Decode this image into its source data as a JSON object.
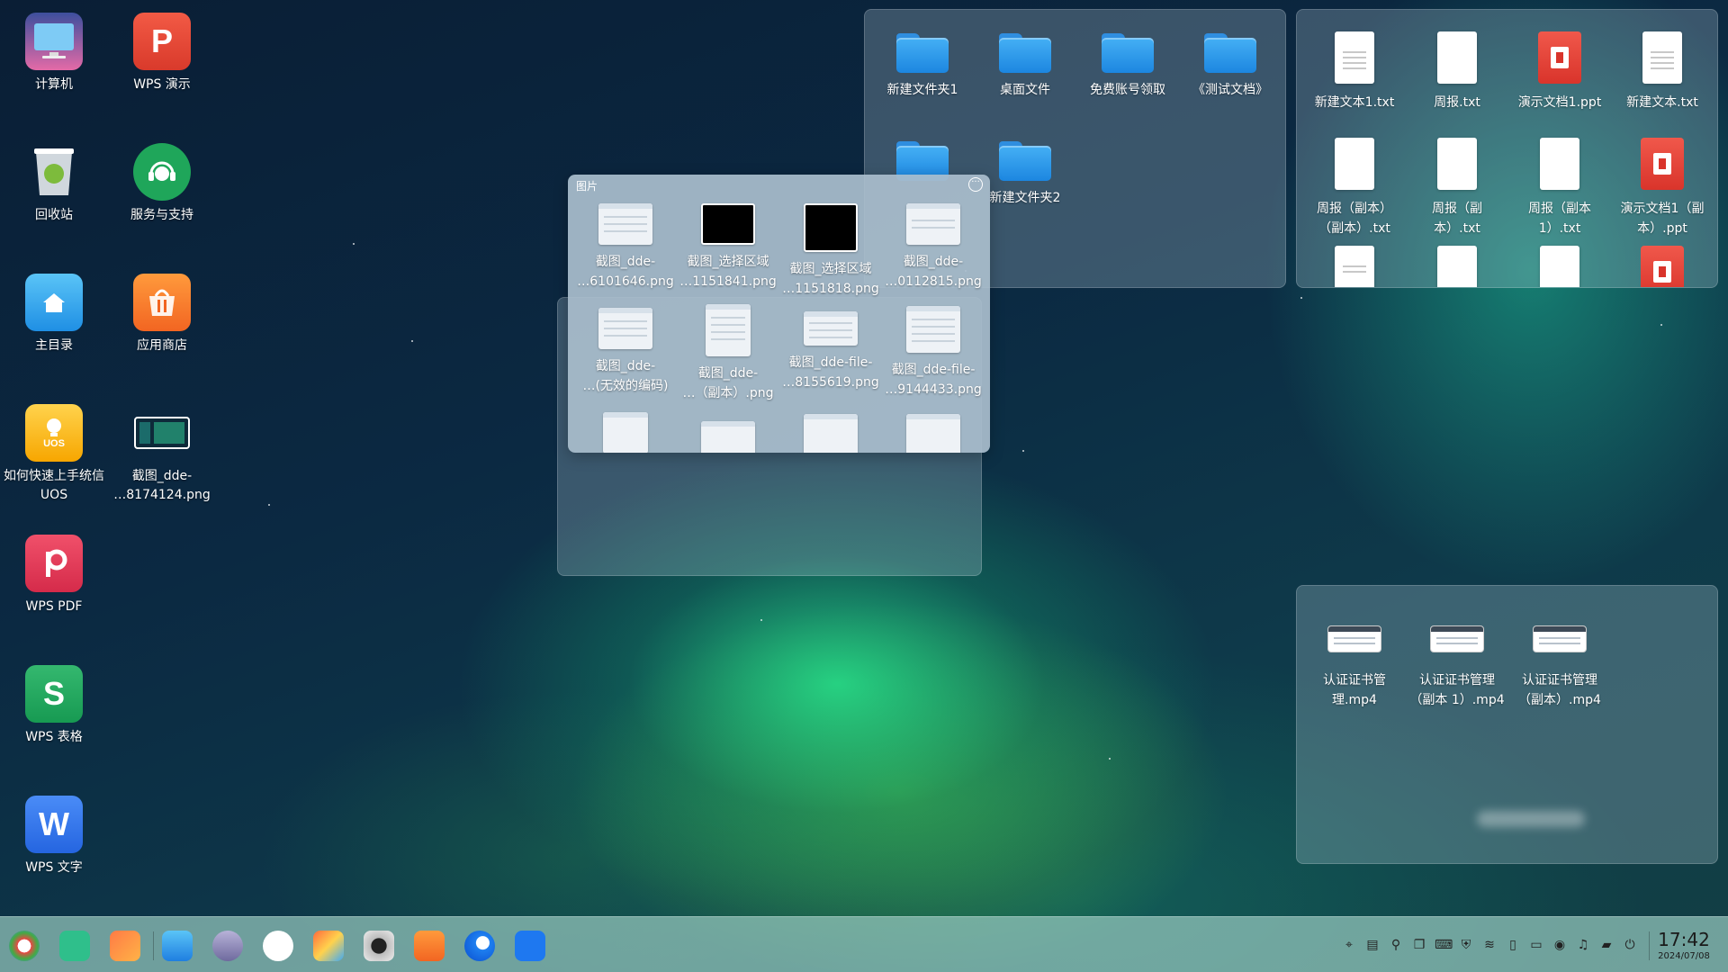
{
  "desktop": {
    "icons": [
      {
        "label": "计算机",
        "icon": "computer-icon"
      },
      {
        "label": "WPS 演示",
        "icon": "wps-presentation-icon"
      },
      {
        "label": "回收站",
        "icon": "trash-icon"
      },
      {
        "label": "服务与支持",
        "icon": "support-icon"
      },
      {
        "label": "主目录",
        "icon": "home-folder-icon"
      },
      {
        "label": "应用商店",
        "icon": "app-store-icon"
      },
      {
        "label": "如何快速上手统信UOS",
        "icon": "uos-guide-icon"
      },
      {
        "label": "截图_dde-\n…8174124.png",
        "icon": "image-file-icon"
      },
      {
        "label": "WPS PDF",
        "icon": "wps-pdf-icon"
      },
      {
        "label": "WPS 表格",
        "icon": "wps-spreadsheet-icon"
      },
      {
        "label": "WPS 文字",
        "icon": "wps-writer-icon"
      }
    ]
  },
  "folders_panel": {
    "items": [
      {
        "label": "新建文件夹1"
      },
      {
        "label": "桌面文件"
      },
      {
        "label": "免费账号领取"
      },
      {
        "label": "《测试文档》"
      },
      {
        "label": "新建文件夹2"
      }
    ]
  },
  "docs_panel": {
    "items": [
      {
        "label": "新建文本1.txt",
        "type": "txt"
      },
      {
        "label": "周报.txt",
        "type": "txt"
      },
      {
        "label": "演示文档1.ppt",
        "type": "ppt"
      },
      {
        "label": "新建文本.txt",
        "type": "txt"
      },
      {
        "label": "周报（副本）\n（副本）.txt",
        "type": "txt"
      },
      {
        "label": "周报（副\n本）.txt",
        "type": "txt"
      },
      {
        "label": "周报（副本\n1）.txt",
        "type": "txt"
      },
      {
        "label": "演示文档1（副\n本）.ppt",
        "type": "ppt"
      }
    ]
  },
  "videos_panel": {
    "items": [
      {
        "label": "认证证书管\n理.mp4"
      },
      {
        "label": "认证证书管理\n（副本 1）.mp4"
      },
      {
        "label": "认证证书管理\n（副本）.mp4"
      }
    ]
  },
  "pictures_popup": {
    "title": "图片",
    "more_icon": "more-options-icon",
    "items": [
      {
        "label": "截图_dde-\n…6101646.png",
        "style": "light"
      },
      {
        "label": "截图_选择区域\n…1151841.png",
        "style": "black"
      },
      {
        "label": "截图_选择区域\n…1151818.png",
        "style": "black"
      },
      {
        "label": "截图_dde-\n…0112815.png",
        "style": "light"
      },
      {
        "label": "截图_dde-\n…(无效的编码)",
        "style": "light"
      },
      {
        "label": "截图_dde-\n…（副本）.png",
        "style": "light"
      },
      {
        "label": "截图_dde-file-\n…8155619.png",
        "style": "light"
      },
      {
        "label": "截图_dde-file-\n…9144433.png",
        "style": "light"
      }
    ]
  },
  "dock": {
    "apps": [
      "launcher-icon",
      "multitask-view-icon",
      "app-grid-icon",
      "file-manager-icon",
      "camera-icon",
      "paint-icon",
      "image-viewer-icon",
      "music-icon",
      "app-store-icon",
      "browser-icon",
      "app-icon"
    ],
    "tray": [
      "input-method-icon",
      "keyboard-icon",
      "search-icon",
      "window-icon",
      "keyboard-layout-icon",
      "security-icon",
      "wifi-icon",
      "clipboard-icon",
      "disk-icon",
      "sound-icon",
      "notification-icon",
      "battery-icon",
      "power-icon"
    ],
    "time": "17:42",
    "date": "2024/07/08"
  }
}
